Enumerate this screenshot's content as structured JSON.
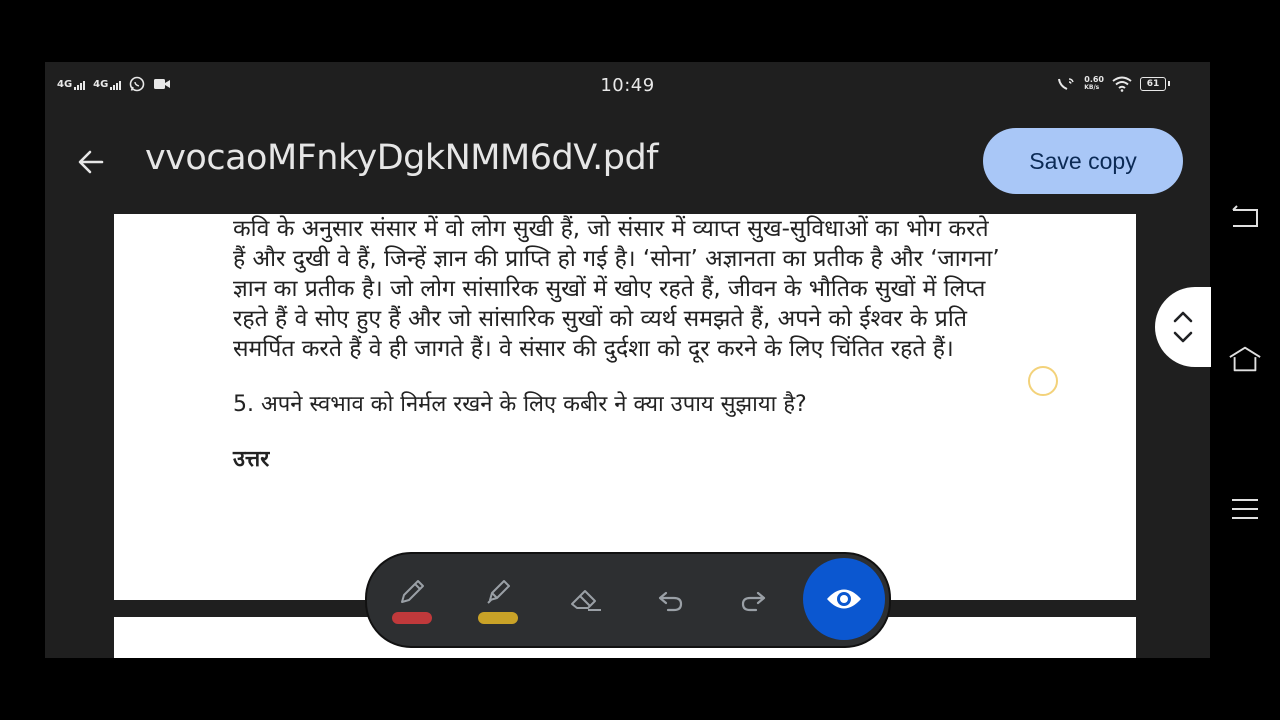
{
  "status_bar": {
    "net1": "4G",
    "net2": "4G",
    "time": "10:49",
    "speed_value": "0.60",
    "speed_unit": "KB/s",
    "battery": "61"
  },
  "app_bar": {
    "title": "vvocaoMFnkyDgkNMM6dV.pdf",
    "save_label": "Save copy"
  },
  "document": {
    "paragraph_lines": [
      "कवि के अनुसार संसार में वो लोग सुखी हैं, जो संसार में व्याप्त सुख-सुविधाओं का भोग करते",
      "हैं और दुखी वे हैं, जिन्हें ज्ञान की प्राप्ति हो गई है। ‘सोना’ अज्ञानता का प्रतीक है और ‘जागना’",
      "ज्ञान का प्रतीक है। जो लोग सांसारिक सुखों में खोए रहते हैं, जीवन के भौतिक सुखों में लिप्त",
      "रहते हैं वे सोए हुए हैं और जो सांसारिक सुखों को व्यर्थ समझते हैं, अपने को ईश्वर के प्रति",
      "समर्पित करते हैं वे ही जागते हैं। वे संसार की दुर्दशा को दूर करने के लिए चिंतित रहते हैं।"
    ],
    "question": "5. अपने स्वभाव को निर्मल रखने के लिए कबीर ने क्या उपाय सुझाया है?",
    "answer_label": "उत्तर"
  },
  "toolbar": {
    "tools": [
      "pen-icon",
      "highlighter-icon",
      "eraser-icon",
      "undo-icon",
      "redo-icon",
      "eye-icon"
    ],
    "pen_color": "#c0393b",
    "highlighter_color": "#c9a227",
    "view_button_color": "#0b57d0"
  },
  "colors": {
    "save_button_bg": "#a9c7f7",
    "app_bg": "#1f1f1f"
  }
}
